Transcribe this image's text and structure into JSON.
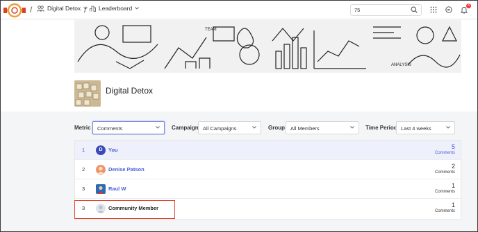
{
  "nav": {
    "group_name": "Digital Detox",
    "page_name": "Leaderboard",
    "search_value": "75",
    "notification_count": "8"
  },
  "group": {
    "title": "Digital Detox"
  },
  "filters": {
    "metric": {
      "label": "Metric",
      "value": "Comments"
    },
    "campaign": {
      "label": "Campaign",
      "value": "All Campaigns"
    },
    "group": {
      "label": "Group",
      "value": "All Members"
    },
    "time_period": {
      "label": "Time Period",
      "value": "Last 4 weeks"
    }
  },
  "leaderboard": [
    {
      "rank": "1",
      "initial": "D",
      "name": "You",
      "score": "5",
      "unit": "Comments"
    },
    {
      "rank": "2",
      "initial": "",
      "name": "Denise Patson",
      "score": "2",
      "unit": "Comments"
    },
    {
      "rank": "3",
      "initial": "",
      "name": "Raul W",
      "score": "1",
      "unit": "Comments"
    },
    {
      "rank": "3",
      "initial": "",
      "name": "Community Member",
      "score": "1",
      "unit": "Comments"
    }
  ],
  "colors": {
    "accent": "#4c5fd5",
    "highlight": "#e2442f",
    "background": "#f4f5f7"
  }
}
